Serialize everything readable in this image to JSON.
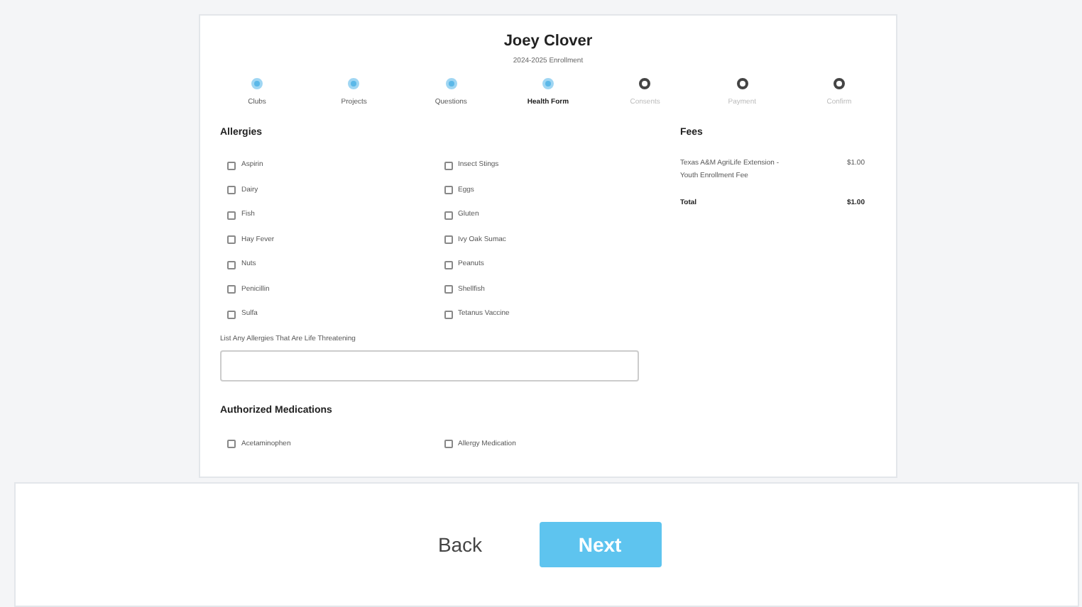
{
  "header": {
    "name": "Joey Clover",
    "subtitle": "2024-2025 Enrollment"
  },
  "steps": [
    {
      "label": "Clubs",
      "completed": true,
      "selected": false
    },
    {
      "label": "Projects",
      "completed": true,
      "selected": false
    },
    {
      "label": "Questions",
      "completed": true,
      "selected": false
    },
    {
      "label": "Health Form",
      "completed": true,
      "selected": true
    },
    {
      "label": "Consents",
      "completed": false,
      "selected": false
    },
    {
      "label": "Payment",
      "completed": false,
      "selected": false
    },
    {
      "label": "Confirm",
      "completed": false,
      "selected": false
    }
  ],
  "allergies": {
    "title": "Allergies",
    "options": [
      {
        "label": "Aspirin",
        "checked": false
      },
      {
        "label": "Insect Stings",
        "checked": false
      },
      {
        "label": "Dairy",
        "checked": false
      },
      {
        "label": "Eggs",
        "checked": false
      },
      {
        "label": "Fish",
        "checked": false
      },
      {
        "label": "Gluten",
        "checked": false
      },
      {
        "label": "Hay Fever",
        "checked": false
      },
      {
        "label": "Ivy Oak Sumac",
        "checked": false
      },
      {
        "label": "Nuts",
        "checked": false
      },
      {
        "label": "Peanuts",
        "checked": false
      },
      {
        "label": "Penicillin",
        "checked": false
      },
      {
        "label": "Shellfish",
        "checked": false
      },
      {
        "label": "Sulfa",
        "checked": false
      },
      {
        "label": "Tetanus Vaccine",
        "checked": false
      }
    ],
    "field_label": "List Any Allergies That Are Life Threatening"
  },
  "medications": {
    "title": "Authorized Medications",
    "options": [
      {
        "label": "Acetaminophen",
        "checked": false
      },
      {
        "label": "Allergy Medication",
        "checked": false
      }
    ]
  },
  "fees": {
    "title": "Fees",
    "items": [
      {
        "name": "Texas A&M AgriLife Extension - Youth Enrollment Fee",
        "amount": "$1.00"
      }
    ],
    "total_label": "Total",
    "total": "$1.00"
  },
  "footer": {
    "back": "Back",
    "next": "Next"
  }
}
